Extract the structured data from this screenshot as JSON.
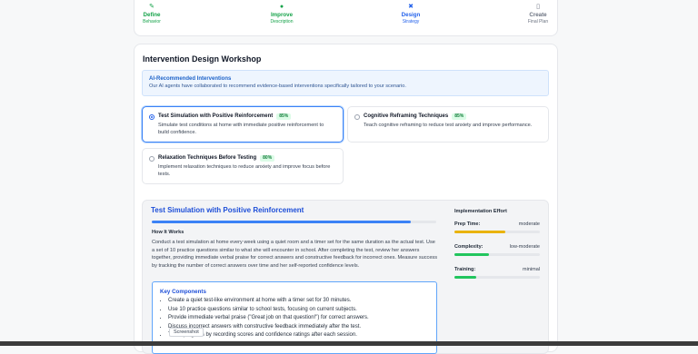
{
  "steps": [
    {
      "title": "Define",
      "sub": "Behavior",
      "icon": "pencil-icon",
      "glyph": "✎",
      "color": "#16a34a"
    },
    {
      "title": "Improve",
      "sub": "Description",
      "icon": "circle-check-icon",
      "glyph": "●",
      "color": "#16a34a"
    },
    {
      "title": "Design",
      "sub": "Strategy",
      "icon": "tools-icon",
      "glyph": "✖",
      "color": "#2563eb"
    },
    {
      "title": "Create",
      "sub": "Final Plan",
      "icon": "document-icon",
      "glyph": "▯",
      "color": "#6b7280"
    }
  ],
  "heading": "Intervention Design Workshop",
  "alert": {
    "title": "AI-Recommended Interventions",
    "text": "Our AI agents have collaborated to recommend evidence-based interventions specifically tailored to your scenario."
  },
  "options": [
    {
      "name": "Test Simulation with Positive Reinforcement",
      "score": "85%",
      "desc": "Simulate test conditions at home with immediate positive reinforcement to build confidence.",
      "selected": true
    },
    {
      "name": "Cognitive Reframing Techniques",
      "score": "85%",
      "desc": "Teach cognitive reframing to reduce test anxiety and improve performance.",
      "selected": false
    },
    {
      "name": "Relaxation Techniques Before Testing",
      "score": "80%",
      "desc": "Implement relaxation techniques to reduce anxiety and improve focus before tests.",
      "selected": false
    }
  ],
  "detail": {
    "title": "Test Simulation with Positive Reinforcement",
    "progress": 0.91,
    "how_title": "How It Works",
    "how_text": "Conduct a test simulation at home every week using a quiet room and a timer set for the same duration as the actual test. Use a set of 10 practice questions similar to what she will encounter in school. After completing the test, review her answers together, providing immediate verbal praise for correct answers and constructive feedback for incorrect ones. Measure success by tracking the number of correct answers over time and her self-reported confidence levels.",
    "key_title": "Key Components",
    "components": [
      "Create a quiet test-like environment at home with a timer set for 30 minutes.",
      "Use 10 practice questions similar to school tests, focusing on current subjects.",
      "Provide immediate verbal praise (\"Great job on that question!\") for correct answers.",
      "Discuss incorrect answers with constructive feedback immediately after the test.",
      "Track progress by recording scores and confidence ratings after each session."
    ]
  },
  "effort": {
    "title": "Implementation Effort",
    "metrics": [
      {
        "label": "Prep Time:",
        "value": "moderate",
        "level": 0.6,
        "color": "#eab308"
      },
      {
        "label": "Complexity:",
        "value": "low-moderate",
        "level": 0.4,
        "color": "#22c55e"
      },
      {
        "label": "Training:",
        "value": "minimal",
        "level": 0.25,
        "color": "#22c55e"
      }
    ]
  },
  "tooltip": "Screenshot"
}
